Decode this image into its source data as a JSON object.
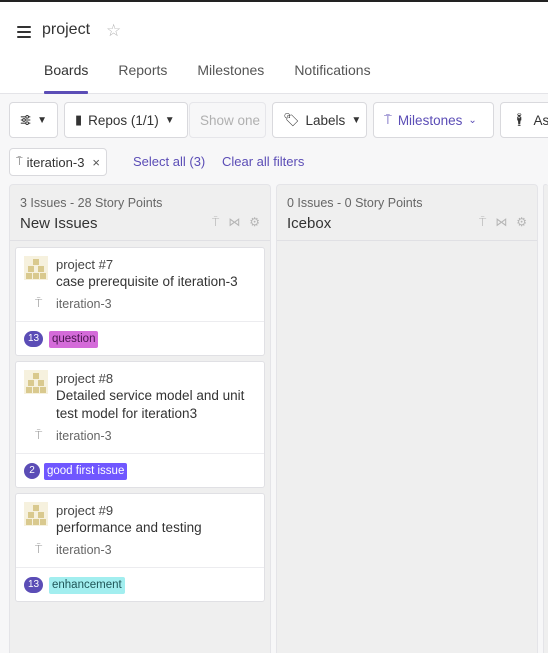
{
  "header": {
    "project": "project",
    "tabs": [
      {
        "label": "Boards",
        "active": true
      },
      {
        "label": "Reports",
        "active": false
      },
      {
        "label": "Milestones",
        "active": false
      },
      {
        "label": "Notifications",
        "active": false
      }
    ]
  },
  "filters": {
    "repos": "Repos (1/1)",
    "show_one": "Show one",
    "labels": "Labels",
    "milestones": "Milestones",
    "assignees": "Assi"
  },
  "active_filters": {
    "chip": "iteration-3",
    "select_all": "Select all (3)",
    "clear_all": "Clear all filters"
  },
  "columns": [
    {
      "title": "New Issues",
      "issues": "3 Issues",
      "points": " - 28 Story Points",
      "cards": [
        {
          "ref": "project #7",
          "title": "case prerequisite of iteration-3",
          "milestone": "iteration-3",
          "points": "13",
          "label": "question",
          "label_bg": "#d46bd9",
          "label_fg": "#4a1550"
        },
        {
          "ref": "project #8",
          "title": "Detailed service model and unit test model for iteration3",
          "milestone": "iteration-3",
          "points": "2",
          "label": "good first issue",
          "label_bg": "#7057ff",
          "label_fg": "#ffffff"
        },
        {
          "ref": "project #9",
          "title": "performance and testing",
          "milestone": "iteration-3",
          "points": "13",
          "label": "enhancement",
          "label_bg": "#a2eeef",
          "label_fg": "#1f5557"
        }
      ]
    },
    {
      "title": "Icebox",
      "issues": "0 Issues",
      "points": " - 0 Story Points",
      "cards": []
    }
  ],
  "colors": {
    "accent": "#5b4db6"
  }
}
